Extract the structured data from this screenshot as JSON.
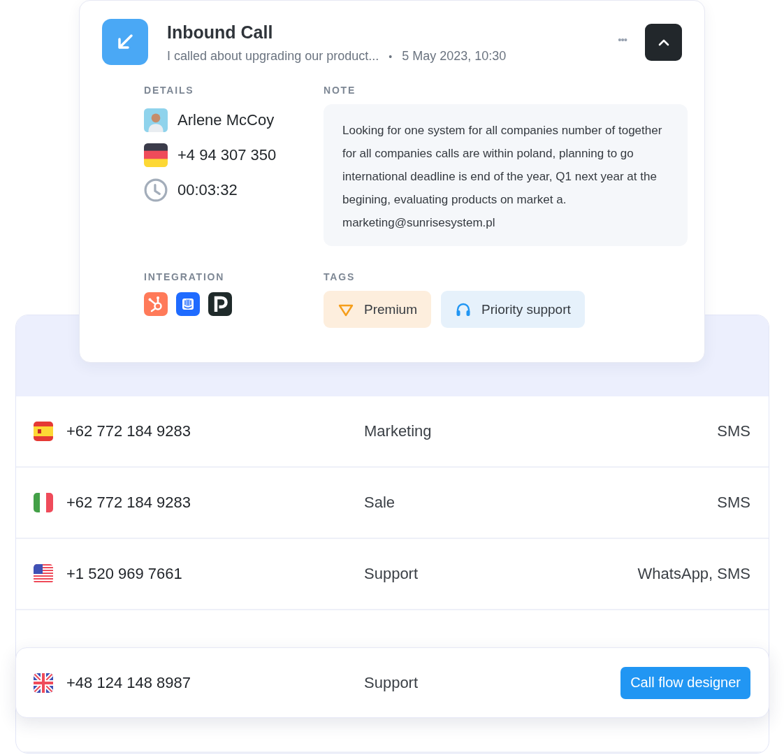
{
  "call": {
    "title": "Inbound Call",
    "summary": "I called about upgrading our product...",
    "separator": "•",
    "time": "5 May 2023, 10:30",
    "more": "•••"
  },
  "details": {
    "label": "DETAILS",
    "name": "Arlene McCoy",
    "phone": {
      "kind": "de",
      "number": "+4 94 307 350"
    },
    "duration": "00:03:32"
  },
  "note": {
    "label": "NOTE",
    "text": "Looking for one system for all companies number of together for all companies calls are within poland, planning to go international deadline is end of the year, Q1 next year at the begining, evaluating products on market a. marketing@sunrisesystem.pl"
  },
  "integration": {
    "label": "INTEGRATION",
    "items": [
      {
        "kind": "hub"
      },
      {
        "kind": "chat"
      },
      {
        "kind": "letter"
      }
    ]
  },
  "tags": {
    "label": "TAGS",
    "items": [
      {
        "kind": "premium",
        "label": "Premium"
      },
      {
        "kind": "support",
        "label": "Priority support"
      }
    ]
  },
  "rows": [
    {
      "kind": "es",
      "number": "+62 772 184 9283",
      "department": "Marketing",
      "channels": "SMS"
    },
    {
      "kind": "it",
      "number": "+62 772 184 9283",
      "department": "Sale",
      "channels": "SMS"
    },
    {
      "kind": "us",
      "number": "+1 520 969 7661",
      "department": "Support",
      "channels": "WhatsApp, SMS"
    }
  ],
  "highlighted_row": {
    "kind": "gb",
    "number": "+48 124 148 8987",
    "department": "Support",
    "button": "Call flow designer"
  }
}
